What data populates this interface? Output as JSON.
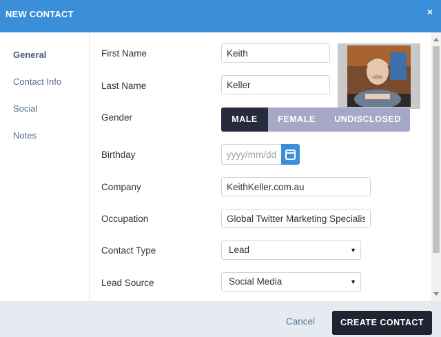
{
  "header": {
    "title": "NEW CONTACT",
    "close_label": "×"
  },
  "sidebar": {
    "items": [
      {
        "label": "General",
        "active": true
      },
      {
        "label": "Contact Info"
      },
      {
        "label": "Social"
      },
      {
        "label": "Notes"
      }
    ]
  },
  "form": {
    "first_name": {
      "label": "First Name",
      "value": "Keith"
    },
    "last_name": {
      "label": "Last Name",
      "value": "Keller"
    },
    "gender": {
      "label": "Gender",
      "options": [
        "MALE",
        "FEMALE",
        "UNDISCLOSED"
      ],
      "selected": "MALE"
    },
    "birthday": {
      "label": "Birthday",
      "placeholder": "yyyy/mm/dd",
      "value": ""
    },
    "company": {
      "label": "Company",
      "value": "KeithKeller.com.au"
    },
    "occupation": {
      "label": "Occupation",
      "value": "Global Twitter Marketing Specialist"
    },
    "contact_type": {
      "label": "Contact Type",
      "value": "Lead"
    },
    "lead_source": {
      "label": "Lead Source",
      "value": "Social Media"
    }
  },
  "footer": {
    "cancel_label": "Cancel",
    "create_label": "CREATE CONTACT"
  },
  "colors": {
    "header": "#3a8fd8",
    "segment_active": "#272b3e",
    "segment_inactive": "#a6a8c7",
    "primary_button": "#202432",
    "footer_bg": "#e6ebf1"
  },
  "icons": {
    "calendar": "calendar-icon",
    "close": "close-icon",
    "dropdown": "chevron-down-icon"
  }
}
